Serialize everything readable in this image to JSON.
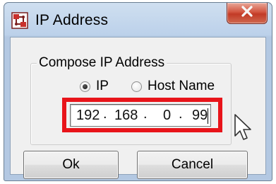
{
  "window": {
    "title": "IP Address",
    "app_icon": "network-icon",
    "close_icon": "close-icon"
  },
  "group": {
    "label": "Compose IP Address",
    "radio_ip_label": "IP",
    "radio_host_label": "Host Name",
    "selected": "IP"
  },
  "ip_field": {
    "octets": [
      "192",
      "168",
      "0",
      "99"
    ],
    "separator": "."
  },
  "buttons": {
    "ok_label": "Ok",
    "cancel_label": "Cancel"
  },
  "colors": {
    "highlight": "#e8141a",
    "close_button": "#c8442e",
    "title_bar": "#bcd1ea",
    "dialog_bg": "#f0f0f0"
  }
}
